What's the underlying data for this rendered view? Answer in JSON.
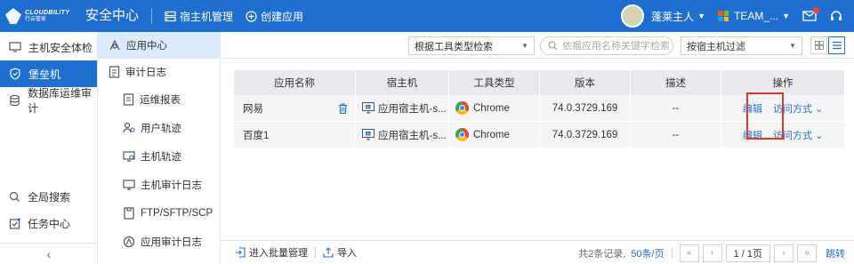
{
  "brand": {
    "name": "CLOUDBILITY",
    "sub": "行云管家"
  },
  "header": {
    "app_title": "安全中心",
    "nav": [
      {
        "label": "宿主机管理",
        "icon": "server-icon"
      },
      {
        "label": "创建应用",
        "icon": "plus-circle-icon"
      }
    ],
    "user_name": "蓬莱主人",
    "team_name": "TEAM_...",
    "colors": {
      "primary": "#1f6fd1"
    }
  },
  "sidebar": {
    "items": [
      {
        "label": "主机安全体检",
        "icon": "host-check-icon"
      },
      {
        "label": "堡垒机",
        "icon": "shield-icon",
        "active": true
      },
      {
        "label": "数据库运维审计",
        "icon": "database-icon"
      }
    ],
    "bottom": [
      {
        "label": "全局搜索",
        "icon": "search-icon"
      },
      {
        "label": "任务中心",
        "icon": "task-icon"
      }
    ],
    "collapse": "‹"
  },
  "subnav": {
    "items": [
      {
        "label": "应用中心",
        "icon": "app-center-icon",
        "active": true
      },
      {
        "label": "审计日志",
        "icon": "audit-log-icon"
      }
    ],
    "children": [
      {
        "label": "运维报表",
        "icon": "report-icon"
      },
      {
        "label": "用户轨迹",
        "icon": "user-track-icon"
      },
      {
        "label": "主机轨迹",
        "icon": "host-track-icon"
      },
      {
        "label": "主机审计日志",
        "icon": "monitor-icon"
      },
      {
        "label": "FTP/SFTP/SCP",
        "icon": "ftp-icon"
      },
      {
        "label": "应用审计日志",
        "icon": "app-audit-icon"
      }
    ]
  },
  "toolbar": {
    "filter_type": "根据工具类型检索",
    "search_placeholder": "依据应用名称关键字检索",
    "filter_host": "按宿主机过滤"
  },
  "table": {
    "columns": [
      "应用名称",
      "宿主机",
      "工具类型",
      "版本",
      "描述",
      "操作"
    ],
    "rows": [
      {
        "name": "网易",
        "host": "应用宿主机-s...",
        "tool": "Chrome",
        "version": "74.0.3729.169",
        "desc": "--",
        "edit": "编辑",
        "access": "访问方式"
      },
      {
        "name": "百度1",
        "host": "应用宿主机-s...",
        "tool": "Chrome",
        "version": "74.0.3729.169",
        "desc": "--",
        "edit": "编辑",
        "access": "访问方式"
      }
    ]
  },
  "footer": {
    "batch": "进入批量管理",
    "import": "导入",
    "total": "共2条记录,",
    "per_page": "50条/页",
    "page_info": "1 / 1页",
    "jump": "跳转",
    "first": "«",
    "prev": "‹",
    "next": "›",
    "last": "»"
  }
}
